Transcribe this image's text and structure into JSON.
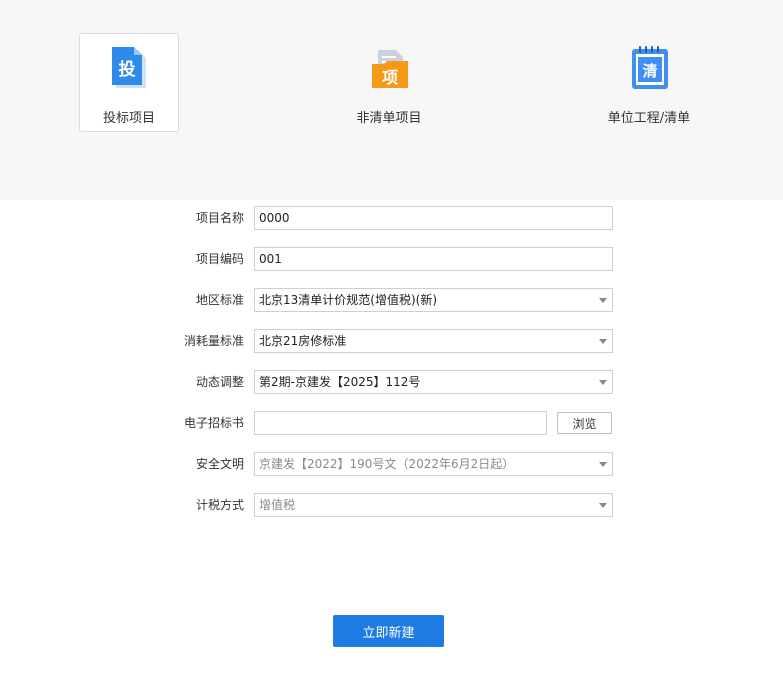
{
  "project_types": [
    {
      "label": "投标项目",
      "icon": "bid-document-icon",
      "glyph": "投",
      "active": true
    },
    {
      "label": "非清单项目",
      "icon": "non-list-folder-icon",
      "glyph": "项",
      "active": false
    },
    {
      "label": "单位工程/清单",
      "icon": "list-notebook-icon",
      "glyph": "清",
      "active": false
    }
  ],
  "form": {
    "project_name": {
      "label": "项目名称",
      "value": "0000"
    },
    "project_code": {
      "label": "项目编码",
      "value": "001"
    },
    "region_standard": {
      "label": "地区标准",
      "value": "北京13清单计价规范(增值税)(新)"
    },
    "consumption_standard": {
      "label": "消耗量标准",
      "value": "北京21房修标准"
    },
    "dynamic_adjustment": {
      "label": "动态调整",
      "value": "第2期-京建发【2025】112号"
    },
    "e_tender": {
      "label": "电子招标书",
      "value": "",
      "browse_label": "浏览"
    },
    "safety_civilization": {
      "label": "安全文明",
      "value": "京建发【2022】190号文（2022年6月2日起）",
      "disabled": true
    },
    "tax_method": {
      "label": "计税方式",
      "value": "增值税",
      "disabled": true
    }
  },
  "create_button": {
    "label": "立即新建"
  },
  "colors": {
    "primary": "#1e7be2",
    "bid_icon": "#2f8be8",
    "folder_icon": "#f59a16",
    "list_icon": "#3f8ff0"
  }
}
